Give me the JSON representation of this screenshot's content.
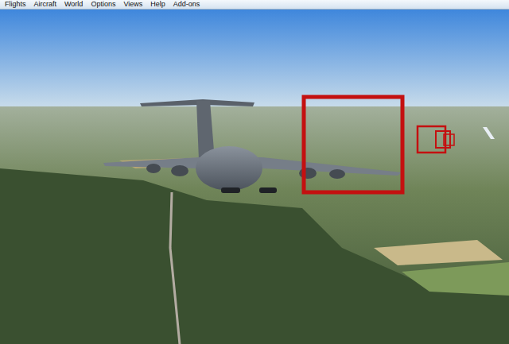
{
  "window": {
    "title": ""
  },
  "menu_bar": [
    {
      "label": "Flights"
    },
    {
      "label": "Aircraft"
    },
    {
      "label": "World"
    },
    {
      "label": "Options"
    },
    {
      "label": "Views"
    },
    {
      "label": "Help"
    },
    {
      "label": "Add-ons"
    }
  ]
}
